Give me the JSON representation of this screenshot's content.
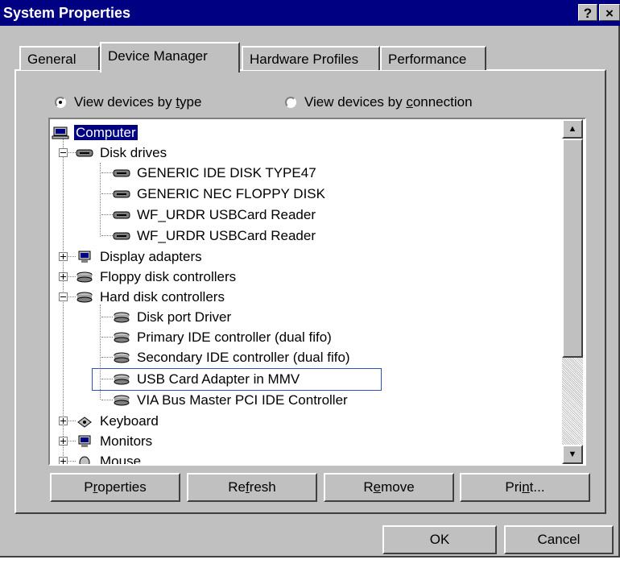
{
  "window": {
    "title": "System Properties",
    "help_label": "?",
    "close_label": "×"
  },
  "tabs": [
    {
      "label": "General"
    },
    {
      "label": "Device Manager",
      "active": true
    },
    {
      "label": "Hardware Profiles"
    },
    {
      "label": "Performance"
    }
  ],
  "view_options": {
    "by_type": {
      "label_pre": "View devices by ",
      "accel": "t",
      "label_post": "ype",
      "selected": true
    },
    "by_connection": {
      "label_pre": "View devices by ",
      "accel": "c",
      "label_post": "onnection",
      "selected": false
    }
  },
  "tree": {
    "root": {
      "label": "Computer",
      "icon": "computer-icon"
    },
    "items": [
      {
        "label": "Disk drives",
        "icon": "disk-drive-icon",
        "expanded": true
      },
      {
        "label": "GENERIC IDE  DISK TYPE47",
        "icon": "disk-drive-icon"
      },
      {
        "label": "GENERIC NEC  FLOPPY DISK",
        "icon": "disk-drive-icon"
      },
      {
        "label": "WF_URDR USBCard Reader",
        "icon": "disk-drive-icon"
      },
      {
        "label": "WF_URDR USBCard Reader",
        "icon": "disk-drive-icon"
      },
      {
        "label": "Display adapters",
        "icon": "display-adapter-icon",
        "expanded": false
      },
      {
        "label": "Floppy disk controllers",
        "icon": "controller-icon",
        "expanded": false
      },
      {
        "label": "Hard disk controllers",
        "icon": "controller-icon",
        "expanded": true
      },
      {
        "label": "Disk port Driver",
        "icon": "controller-icon"
      },
      {
        "label": "Primary IDE controller (dual fifo)",
        "icon": "controller-icon"
      },
      {
        "label": "Secondary IDE controller (dual fifo)",
        "icon": "controller-icon"
      },
      {
        "label": "USB Card Adapter in MMV",
        "icon": "controller-icon",
        "focused": true
      },
      {
        "label": "VIA Bus Master PCI IDE Controller",
        "icon": "controller-icon"
      },
      {
        "label": "Keyboard",
        "icon": "keyboard-icon",
        "expanded": false
      },
      {
        "label": "Monitors",
        "icon": "monitor-icon",
        "expanded": false
      },
      {
        "label": "Mouse",
        "icon": "mouse-icon",
        "expanded": false
      }
    ]
  },
  "buttons": {
    "properties": {
      "pre": "P",
      "accel": "r",
      "post": "operties"
    },
    "refresh": {
      "pre": "Re",
      "accel": "f",
      "post": "resh"
    },
    "remove": {
      "pre": "R",
      "accel": "e",
      "post": "move"
    },
    "print": {
      "pre": "Pri",
      "accel": "n",
      "post": "t..."
    },
    "ok": "OK",
    "cancel": "Cancel"
  }
}
